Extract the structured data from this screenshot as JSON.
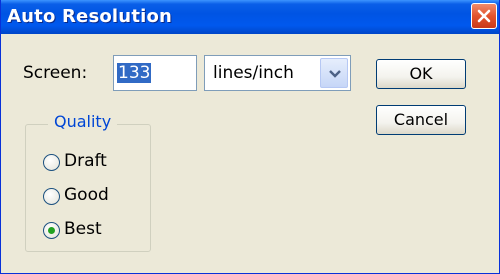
{
  "window": {
    "title": "Auto Resolution",
    "close_icon": "close-icon"
  },
  "screen": {
    "label": "Screen:",
    "value": "133",
    "units": "lines/inch",
    "dropdown_icon": "chevron-down-icon"
  },
  "buttons": {
    "ok": "OK",
    "cancel": "Cancel"
  },
  "quality": {
    "legend": "Quality",
    "options": [
      {
        "label": "Draft",
        "selected": false
      },
      {
        "label": "Good",
        "selected": false
      },
      {
        "label": "Best",
        "selected": true
      }
    ]
  },
  "colors": {
    "titlebar": "#0054e3",
    "dialog_bg": "#ece9d8",
    "legend_text": "#0046d5",
    "selection": "#316ac5",
    "radio_selected": "#21a121"
  }
}
